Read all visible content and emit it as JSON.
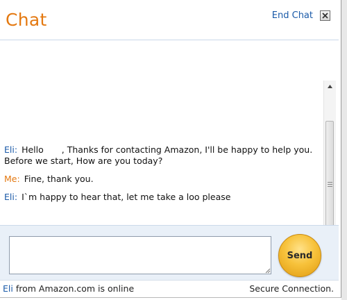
{
  "header": {
    "title": "Chat",
    "end_chat_label": "End Chat"
  },
  "messages": [
    {
      "speaker": "Eli:",
      "role": "agent",
      "text_before": "Hello",
      "text_after": ", Thanks for contacting Amazon, I'll be happy to help you."
    },
    {
      "speaker": "",
      "role": "agent",
      "text": "Before we start, How are you today?"
    },
    {
      "speaker": "Me:",
      "role": "me",
      "text": "Fine, thank you."
    },
    {
      "speaker": "Eli:",
      "role": "agent",
      "text": "I`m happy to hear that, let me take a loo please"
    }
  ],
  "compose": {
    "input_value": "",
    "send_label": "Send"
  },
  "status": {
    "agent_name": "Eli",
    "online_text": "from Amazon.com is online",
    "security_text": "Secure Connection."
  },
  "colors": {
    "brand_orange": "#e47911",
    "link_blue": "#1a5aa8",
    "send_gold": "#f7c23b"
  }
}
